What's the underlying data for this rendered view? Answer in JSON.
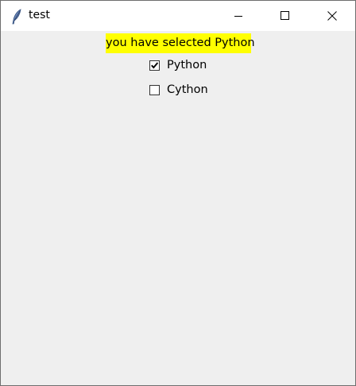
{
  "window": {
    "title": "test",
    "icon": "feather-icon"
  },
  "controls": {
    "minimize": "minimize-icon",
    "maximize": "maximize-icon",
    "close": "close-icon"
  },
  "status": {
    "text": "you have selected Python",
    "background": "#ffff00"
  },
  "options": [
    {
      "label": "Python",
      "checked": true
    },
    {
      "label": "Cython",
      "checked": false
    }
  ]
}
